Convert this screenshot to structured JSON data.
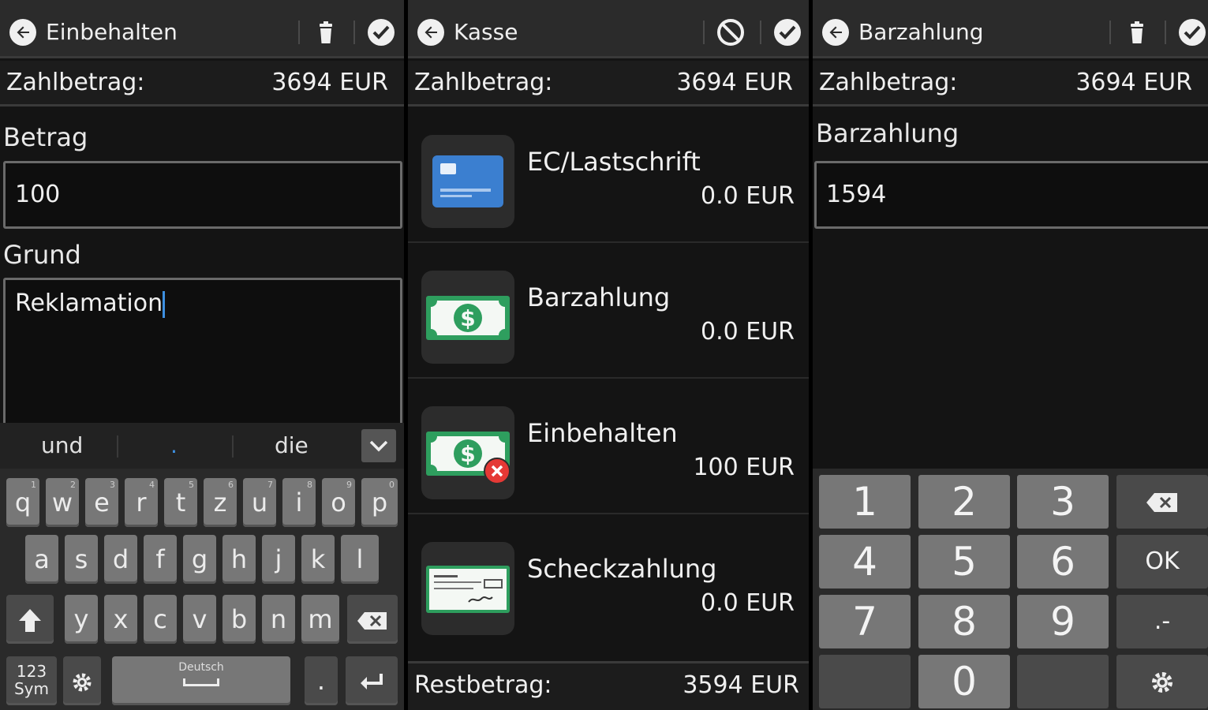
{
  "panels": [
    {
      "title": "Einbehalten",
      "zahlbetrag_label": "Zahlbetrag:",
      "zahlbetrag_value": "3694 EUR",
      "betrag_label": "Betrag",
      "betrag_value": "100",
      "grund_label": "Grund",
      "grund_value": "Reklamation",
      "suggestions": [
        "und",
        ".",
        "die"
      ],
      "keyboard": {
        "row1": [
          "q",
          "w",
          "e",
          "r",
          "t",
          "z",
          "u",
          "i",
          "o",
          "p"
        ],
        "row1_nums": [
          "1",
          "2",
          "3",
          "4",
          "5",
          "6",
          "7",
          "8",
          "9",
          "0"
        ],
        "row2": [
          "a",
          "s",
          "d",
          "f",
          "g",
          "h",
          "j",
          "k",
          "l"
        ],
        "row3": [
          "y",
          "x",
          "c",
          "v",
          "b",
          "n",
          "m"
        ],
        "sym_line1": "123",
        "sym_line2": "Sym",
        "space_label": "Deutsch",
        "period": "."
      },
      "icons": {
        "back": "back-arrow-icon",
        "delete": "trash-icon",
        "confirm": "check-icon"
      }
    },
    {
      "title": "Kasse",
      "zahlbetrag_label": "Zahlbetrag:",
      "zahlbetrag_value": "3694 EUR",
      "methods": [
        {
          "name": "EC/Lastschrift",
          "value": "0.0 EUR",
          "icon": "credit-card-icon"
        },
        {
          "name": "Barzahlung",
          "value": "0.0 EUR",
          "icon": "cash-icon"
        },
        {
          "name": "Einbehalten",
          "value": "100 EUR",
          "icon": "cash-withheld-icon"
        },
        {
          "name": "Scheckzahlung",
          "value": "0.0 EUR",
          "icon": "cheque-icon"
        }
      ],
      "restbetrag_label": "Restbetrag:",
      "restbetrag_value": "3594 EUR",
      "icons": {
        "back": "back-arrow-icon",
        "cancel": "cancel-icon",
        "confirm": "check-icon"
      }
    },
    {
      "title": "Barzahlung",
      "zahlbetrag_label": "Zahlbetrag:",
      "zahlbetrag_value": "3694 EUR",
      "field_label": "Barzahlung",
      "field_value": "1594",
      "numpad": {
        "digits": [
          "1",
          "2",
          "3",
          "4",
          "5",
          "6",
          "7",
          "8",
          "9",
          "0"
        ],
        "ok": "OK",
        "minus": ".-"
      },
      "icons": {
        "back": "back-arrow-icon",
        "delete": "trash-icon",
        "confirm": "check-icon"
      }
    }
  ],
  "colors": {
    "background": "#141414",
    "actionbar": "#2b2b2b",
    "key": "#777777",
    "key_dark": "#4a4a4a",
    "cash_green": "#2e9e5e",
    "card_blue": "#3b7fd0",
    "error_red": "#e53935"
  }
}
